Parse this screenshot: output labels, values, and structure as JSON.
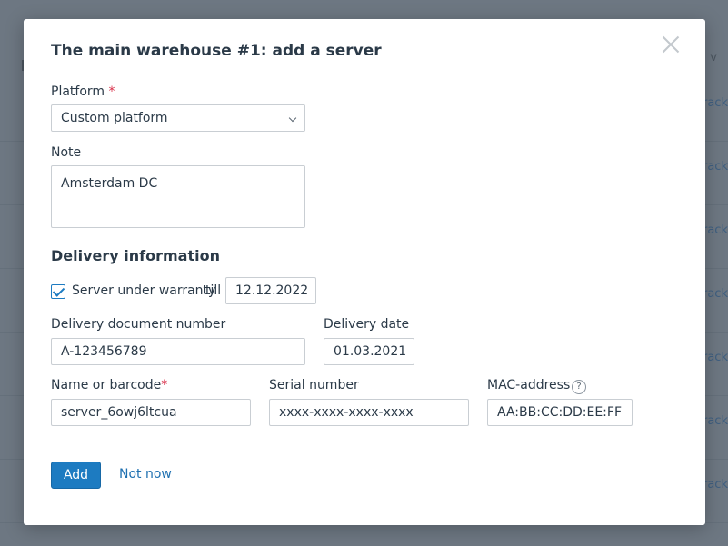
{
  "background": {
    "column_header": "v",
    "row_link_text": "rack"
  },
  "modal": {
    "title": "The main warehouse #1: add a server",
    "platform": {
      "label": "Platform",
      "required_mark": "*",
      "value": "Custom platform"
    },
    "note": {
      "label": "Note",
      "value": "Amsterdam DC"
    },
    "delivery": {
      "section_title": "Delivery information",
      "warranty": {
        "checked": true,
        "label": "Server under warranty",
        "till_label": "till",
        "date": "12.12.2022"
      },
      "document_number": {
        "label": "Delivery document number",
        "value": "A-123456789"
      },
      "delivery_date": {
        "label": "Delivery date",
        "value": "01.03.2021"
      },
      "name_barcode": {
        "label": "Name or barcode",
        "required_mark": "*",
        "value": "server_6owj6ltcua"
      },
      "serial_number": {
        "label": "Serial number",
        "value": "xxxx-xxxx-xxxx-xxxx"
      },
      "mac_address": {
        "label": "MAC-address",
        "help_glyph": "?",
        "value": "AA:BB:CC:DD:EE:FF"
      }
    },
    "actions": {
      "add_label": "Add",
      "cancel_label": "Not now"
    }
  },
  "colors": {
    "accent": "#1d7bc1",
    "required": "#d9304a",
    "overlay": "#6d7782"
  }
}
